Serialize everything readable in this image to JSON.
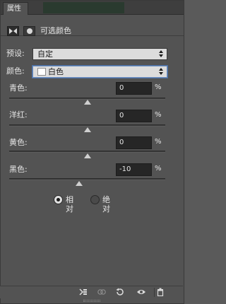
{
  "panel": {
    "tab_label": "属性",
    "title": "可选颜色"
  },
  "preset": {
    "label": "预设:",
    "value": "自定"
  },
  "colors": {
    "label": "颜色:",
    "value": "白色",
    "swatch_color": "#ffffff"
  },
  "sliders": [
    {
      "label": "青色:",
      "value": "0",
      "unit": "%",
      "position": 0.5
    },
    {
      "label": "洋红:",
      "value": "0",
      "unit": "%",
      "position": 0.5
    },
    {
      "label": "黄色:",
      "value": "0",
      "unit": "%",
      "position": 0.5
    },
    {
      "label": "黑色:",
      "value": "-10",
      "unit": "%",
      "position": 0.45
    }
  ],
  "method": {
    "options": [
      {
        "label": "相对",
        "selected": true
      },
      {
        "label": "绝对",
        "selected": false
      }
    ]
  },
  "footer": {
    "icons": [
      "clip-to-layer-icon",
      "view-previous-state-icon",
      "reset-icon",
      "visibility-eye-icon",
      "trash-icon"
    ]
  }
}
